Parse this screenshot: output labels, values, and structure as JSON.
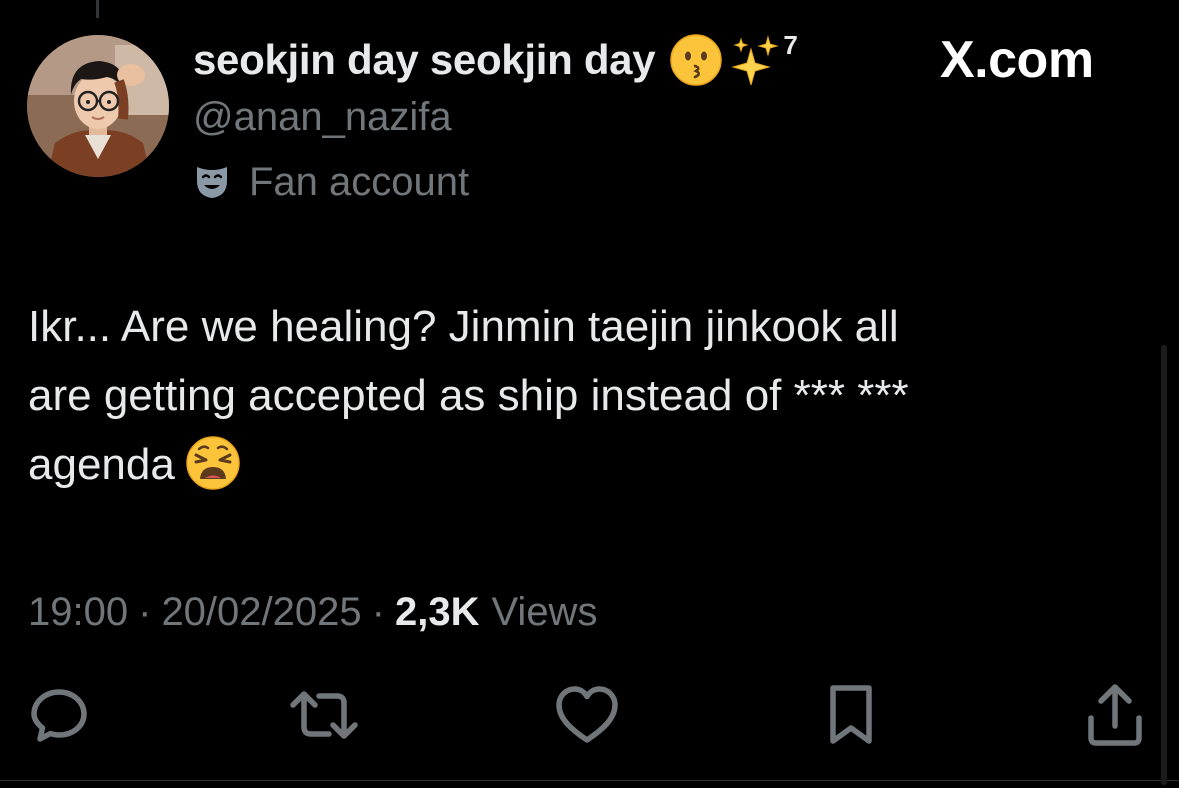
{
  "author": {
    "display_name": "seokjin day seokjin day",
    "name_emojis": [
      "kissing-face-emoji",
      "sparkles-emoji"
    ],
    "name_suffix": "7",
    "handle": "@anan_nazifa",
    "account_label": "Fan account",
    "account_label_icon": "theater-masks-icon"
  },
  "watermark": "X.com",
  "tweet": {
    "lines": [
      "Ikr... Are we healing? Jinmin taejin jinkook all",
      "are getting accepted as ship instead of *** ***",
      "agenda"
    ],
    "trailing_emoji": "weary-face-emoji"
  },
  "meta": {
    "time": "19:00",
    "separator": "·",
    "date": "20/02/2025",
    "views_count": "2,3K",
    "views_label": "Views"
  },
  "actions": [
    {
      "name": "reply",
      "icon": "reply-icon"
    },
    {
      "name": "repost",
      "icon": "repost-icon"
    },
    {
      "name": "like",
      "icon": "heart-icon"
    },
    {
      "name": "bookmark",
      "icon": "bookmark-icon"
    },
    {
      "name": "share",
      "icon": "share-icon"
    }
  ],
  "colors": {
    "background": "#000000",
    "primary_text": "#e7e9ea",
    "secondary_text": "#71767b",
    "icon_gray": "#71767b"
  }
}
